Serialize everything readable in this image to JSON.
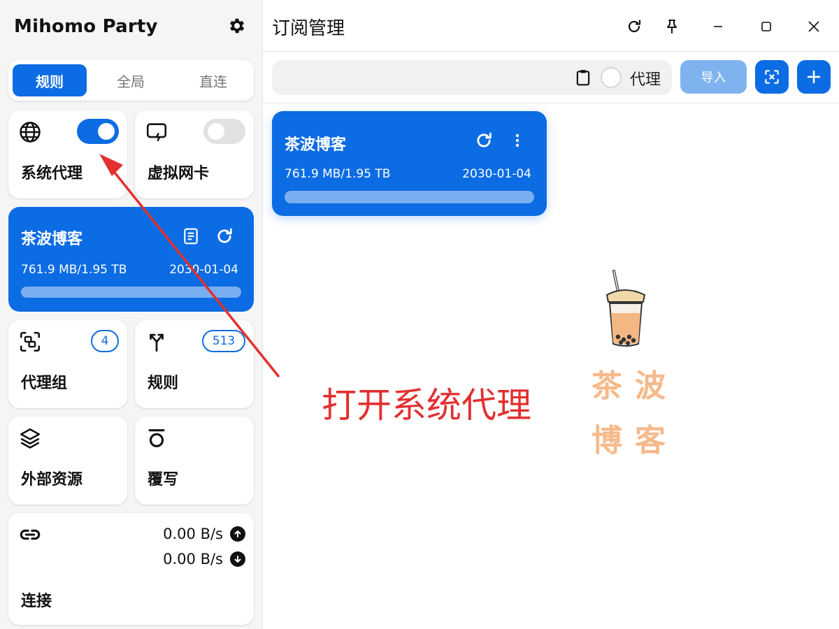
{
  "sidebar": {
    "brand": "Mihomo Party",
    "brand_first": "M",
    "brand_rest": "ihomo Party",
    "modes": [
      "规则",
      "全局",
      "直连"
    ],
    "active_mode": "规则",
    "system_proxy": {
      "label": "系统代理",
      "enabled": true
    },
    "tun": {
      "label": "虚拟网卡",
      "enabled": false
    },
    "subscription": {
      "name": "茶波博客",
      "usage": "761.9 MB/1.95 TB",
      "expire": "2030-01-04"
    },
    "proxy_groups": {
      "label": "代理组",
      "count": "4"
    },
    "rules": {
      "label": "规则",
      "count": "513"
    },
    "resources": {
      "label": "外部资源"
    },
    "override": {
      "label": "覆写"
    },
    "connections": {
      "label": "连接",
      "upload": "0.00 B/s",
      "download": "0.00 B/s"
    }
  },
  "main": {
    "title": "订阅管理",
    "toolbar": {
      "url_placeholder": "",
      "proxy_label": "代理",
      "import_label": "导入"
    },
    "profile": {
      "name": "茶波博客",
      "usage": "761.9 MB/1.95 TB",
      "expire": "2030-01-04"
    },
    "watermark": {
      "line1": "茶波",
      "line2": "博客"
    }
  },
  "annotation": {
    "text": "打开系统代理"
  },
  "colors": {
    "accent": "#0c6ce3",
    "annotation": "#e23030",
    "watermark": "#f6b98a"
  },
  "icons": [
    "settings-icon",
    "globe-icon",
    "tun-icon",
    "file-icon",
    "refresh-icon",
    "proxy-group-icon",
    "rules-icon",
    "layers-icon",
    "override-icon",
    "link-icon",
    "upload-icon",
    "download-icon",
    "pin-icon",
    "minimize-icon",
    "maximize-icon",
    "close-icon",
    "clipboard-icon",
    "qr-scan-icon",
    "plus-icon",
    "more-vert-icon",
    "boba-tea-icon"
  ]
}
